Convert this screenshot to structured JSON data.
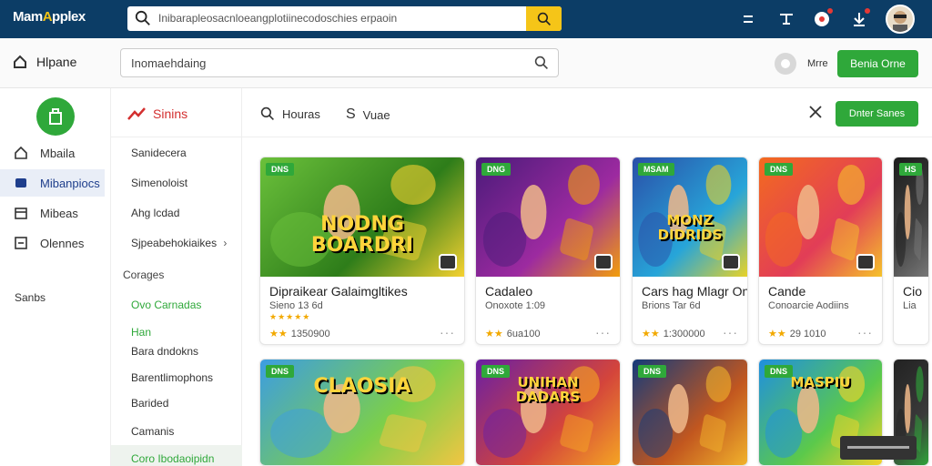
{
  "app": {
    "logo_prefix": "Mam",
    "logo_accent": "A",
    "logo_suffix": "pplex"
  },
  "top_search": {
    "text": "Inibarapleosacnloeangplotiinecodoschies erpaoin"
  },
  "subbar": {
    "home_label": "Hlpane",
    "search_text": "Inomaehdaing",
    "toggle_label": "Mrre",
    "action_button": "Benia Orne"
  },
  "sidebar": {
    "items": [
      {
        "label": "Mbaila",
        "icon": "home-icon"
      },
      {
        "label": "Mibanpiocs",
        "icon": "apps-icon",
        "active": true
      },
      {
        "label": "Mibeas",
        "icon": "calendar-icon"
      },
      {
        "label": "Olennes",
        "icon": "list-icon"
      }
    ],
    "section": "Sanbs"
  },
  "categories": {
    "heading": "Sinins",
    "items": [
      "Sanidecera",
      "Simenoloist",
      "Ahg lcdad",
      "Sjpeabehokiaikes",
      "Corages",
      "Ovo Carnadas",
      "Han",
      "Bara dndokns",
      "Barentlimophons",
      "Barided",
      "Camanis",
      "Coro Ibodaoipidn"
    ]
  },
  "toolbar": {
    "tab1": "Houras",
    "tab2": "Vuae",
    "button": "Dnter Sanes"
  },
  "cards": [
    {
      "badge": "DNS",
      "art_text": "NODNG BOARDRI",
      "title": "Dipraikear Galaimgltikes",
      "sub": "Sieno 13 6d",
      "count": "1350900",
      "colors": [
        "#6bc13b",
        "#2e7d1a",
        "#f5d130"
      ]
    },
    {
      "badge": "DNG",
      "art_text": "",
      "title": "Cadaleo",
      "sub": "Onoxote 1:09",
      "count": "6ua100",
      "colors": [
        "#4b1b7a",
        "#9c2aa0",
        "#f29e0c"
      ]
    },
    {
      "badge": "MSAM",
      "art_text": "MONZ DIDRIDS",
      "title": "Cars hag Mlagr On",
      "sub": "Brions Tar 6d",
      "count": "1:300000",
      "colors": [
        "#2a4fa8",
        "#27a5d9",
        "#e7d228"
      ]
    },
    {
      "badge": "DNS",
      "art_text": "",
      "title": "Cande",
      "sub": "Conoarcie Aodiins",
      "count": "29 1010",
      "colors": [
        "#f36b1f",
        "#e23d57",
        "#f5c22b"
      ]
    },
    {
      "badge": "HS",
      "art_text": "",
      "title": "Cio",
      "sub": "Lia",
      "count": "",
      "colors": [
        "#1b1b1b",
        "#444",
        "#777"
      ]
    },
    {
      "badge": "DNS",
      "art_text": "CLAOSIA",
      "title": "",
      "sub": "",
      "count": "",
      "colors": [
        "#3c9de2",
        "#7ccf4a",
        "#f4c542"
      ]
    },
    {
      "badge": "DNS",
      "art_text": "UNIHAN DADARS",
      "title": "",
      "sub": "",
      "count": "",
      "colors": [
        "#6a1fa3",
        "#d4453b",
        "#f5a623"
      ]
    },
    {
      "badge": "DNS",
      "art_text": "",
      "title": "",
      "sub": "",
      "count": "",
      "colors": [
        "#143a7a",
        "#c2571f",
        "#f2b42c"
      ]
    },
    {
      "badge": "DNS",
      "art_text": "MASPIU",
      "title": "",
      "sub": "",
      "count": "",
      "colors": [
        "#1f8fe0",
        "#5bc94b",
        "#f6d32b"
      ]
    },
    {
      "badge": "",
      "art_text": "",
      "title": "",
      "sub": "",
      "count": "",
      "colors": [
        "#222",
        "#3a3a3a",
        "#2fa83a"
      ]
    }
  ]
}
